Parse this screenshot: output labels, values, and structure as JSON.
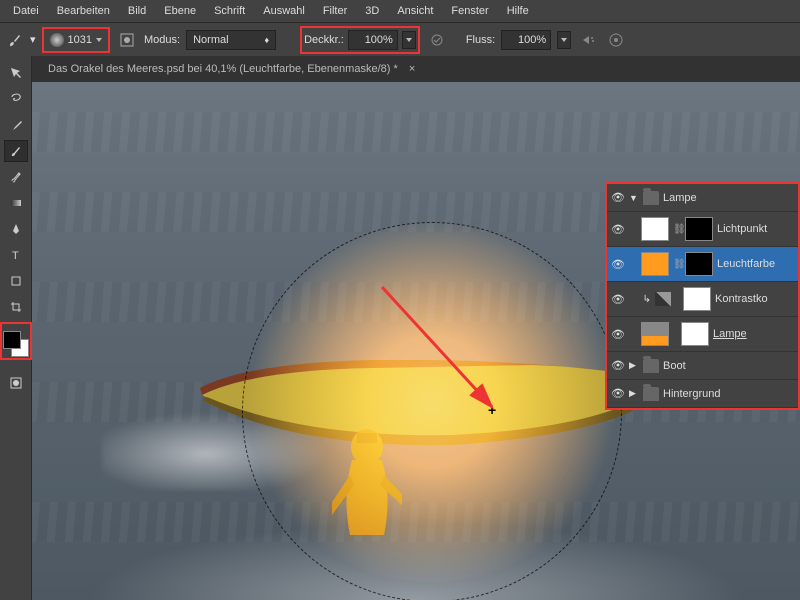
{
  "menu": [
    "Datei",
    "Bearbeiten",
    "Bild",
    "Ebene",
    "Schrift",
    "Auswahl",
    "Filter",
    "3D",
    "Ansicht",
    "Fenster",
    "Hilfe"
  ],
  "options": {
    "brush_size": "1031",
    "mode_label": "Modus:",
    "mode_value": "Normal",
    "opacity_label": "Deckkr.:",
    "opacity_value": "100%",
    "flow_label": "Fluss:",
    "flow_value": "100%"
  },
  "document": {
    "tab_title": "Das Orakel des Meeres.psd bei 40,1%  (Leuchtfarbe, Ebenenmaske/8) *"
  },
  "layers": {
    "group": "Lampe",
    "items": [
      {
        "name": "Lichtpunkt"
      },
      {
        "name": "Leuchtfarbe"
      },
      {
        "name": "Kontrastko"
      },
      {
        "name": "Lampe"
      }
    ],
    "groups_below": [
      "Boot",
      "Hintergrund"
    ]
  }
}
